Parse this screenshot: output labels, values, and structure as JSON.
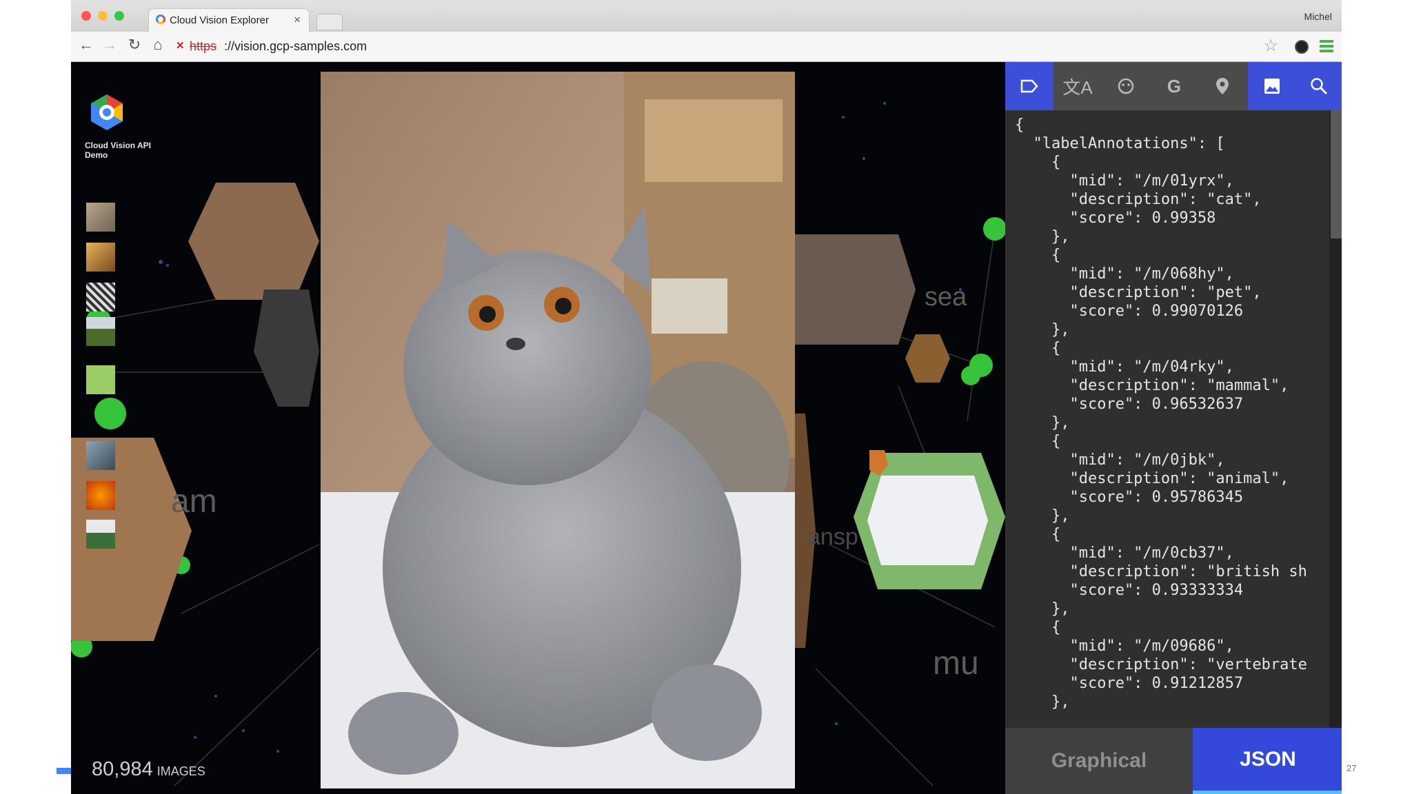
{
  "browser": {
    "tab_title": "Cloud Vision Explorer",
    "tab_close": "×",
    "profile_name": "Michel",
    "url_scheme": "https",
    "url_host": "://vision.gcp-samples.com"
  },
  "app": {
    "logo_title": "Cloud Vision API Demo",
    "image_count": "80,984",
    "image_count_label": "IMAGES",
    "floating_words": [
      "am",
      "sea",
      "ansp",
      "mu"
    ]
  },
  "panel": {
    "tabs": [
      "label-icon",
      "translate-icon",
      "face-icon",
      "google-icon",
      "location-icon",
      "image-icon",
      "search-icon"
    ],
    "json_text": "{\n  \"labelAnnotations\": [\n    {\n      \"mid\": \"/m/01yrx\",\n      \"description\": \"cat\",\n      \"score\": 0.99358\n    },\n    {\n      \"mid\": \"/m/068hy\",\n      \"description\": \"pet\",\n      \"score\": 0.99070126\n    },\n    {\n      \"mid\": \"/m/04rky\",\n      \"description\": \"mammal\",\n      \"score\": 0.96532637\n    },\n    {\n      \"mid\": \"/m/0jbk\",\n      \"description\": \"animal\",\n      \"score\": 0.95786345\n    },\n    {\n      \"mid\": \"/m/0cb37\",\n      \"description\": \"british sh\n      \"score\": 0.93333334\n    },\n    {\n      \"mid\": \"/m/09686\",\n      \"description\": \"vertebrate\n      \"score\": 0.91212857\n    },",
    "graphical_label": "Graphical",
    "json_label": "JSON"
  },
  "slide": {
    "page_number": "27"
  },
  "colors": {
    "accent_blue": "#3249d9",
    "node_green": "#36c43a",
    "page_bg": "#040509"
  }
}
